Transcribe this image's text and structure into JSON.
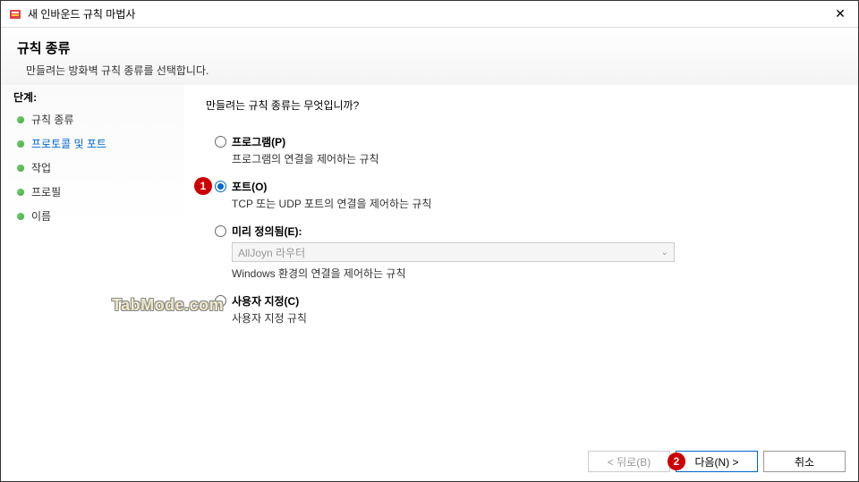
{
  "window": {
    "title": "새 인바운드 규칙 마법사"
  },
  "header": {
    "title": "규칙 종류",
    "subtitle": "만들려는 방화벽 규칙 종류를 선택합니다."
  },
  "sidebar": {
    "header": "단계:",
    "items": [
      {
        "label": "규칙 종류",
        "active": false
      },
      {
        "label": "프로토콜 및 포트",
        "active": true
      },
      {
        "label": "작업",
        "active": false
      },
      {
        "label": "프로필",
        "active": false
      },
      {
        "label": "이름",
        "active": false
      }
    ]
  },
  "main": {
    "question": "만들려는 규칙 종류는 무엇입니까?",
    "options": [
      {
        "label": "프로그램(P)",
        "desc": "프로그램의 연결을 제어하는 규칙",
        "checked": false
      },
      {
        "label": "포트(O)",
        "desc": "TCP 또는 UDP 포트의 연결을 제어하는 규칙",
        "checked": true,
        "badge": "1"
      },
      {
        "label": "미리 정의됨(E):",
        "desc": "Windows 환경의 연결을 제어하는 규칙",
        "checked": false,
        "dropdown": "AllJoyn 라우터"
      },
      {
        "label": "사용자 지정(C)",
        "desc": "사용자 지정 규칙",
        "checked": false
      }
    ]
  },
  "footer": {
    "back": "< 뒤로(B)",
    "next": "다음(N) >",
    "cancel": "취소",
    "next_badge": "2"
  },
  "watermark": "TabMode.com"
}
